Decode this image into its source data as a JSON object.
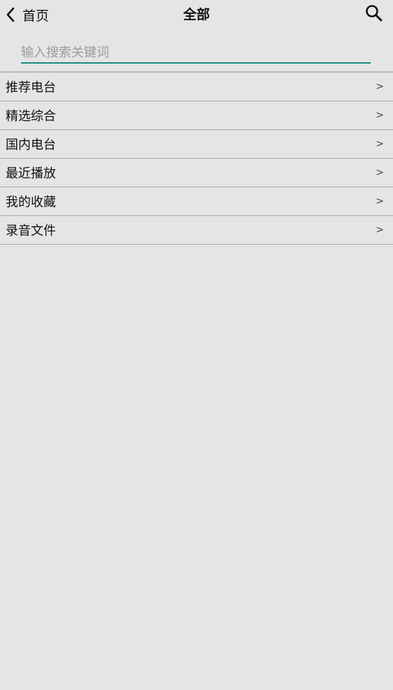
{
  "header": {
    "back_label": "首页",
    "title": "全部",
    "back_icon": "chevron-left-icon",
    "search_icon": "search-icon"
  },
  "search": {
    "placeholder": "输入搜索关键词",
    "value": "",
    "accent_color": "#1a8a7e"
  },
  "list": {
    "chevron": ">",
    "items": [
      {
        "label": "推荐电台"
      },
      {
        "label": "精选综合"
      },
      {
        "label": "国内电台"
      },
      {
        "label": "最近播放"
      },
      {
        "label": "我的收藏"
      },
      {
        "label": "录音文件"
      }
    ]
  }
}
